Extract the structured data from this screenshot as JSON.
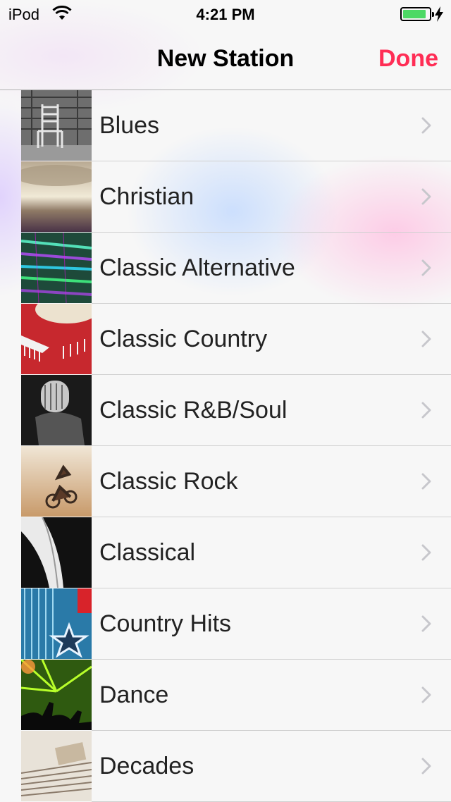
{
  "status_bar": {
    "carrier": "iPod",
    "time": "4:21 PM",
    "battery_level": 0.9,
    "battery_color": "#4cd964"
  },
  "nav": {
    "title": "New Station",
    "done_label": "Done",
    "accent_color": "#ff2d55"
  },
  "stations": [
    {
      "label": "Blues",
      "thumb_icon": "blues-photo"
    },
    {
      "label": "Christian",
      "thumb_icon": "christian-photo"
    },
    {
      "label": "Classic Alternative",
      "thumb_icon": "classic-alternative-photo"
    },
    {
      "label": "Classic Country",
      "thumb_icon": "classic-country-photo"
    },
    {
      "label": "Classic R&B/Soul",
      "thumb_icon": "classic-rnb-soul-photo"
    },
    {
      "label": "Classic Rock",
      "thumb_icon": "classic-rock-photo"
    },
    {
      "label": "Classical",
      "thumb_icon": "classical-photo"
    },
    {
      "label": "Country Hits",
      "thumb_icon": "country-hits-photo"
    },
    {
      "label": "Dance",
      "thumb_icon": "dance-photo"
    },
    {
      "label": "Decades",
      "thumb_icon": "decades-photo"
    }
  ]
}
